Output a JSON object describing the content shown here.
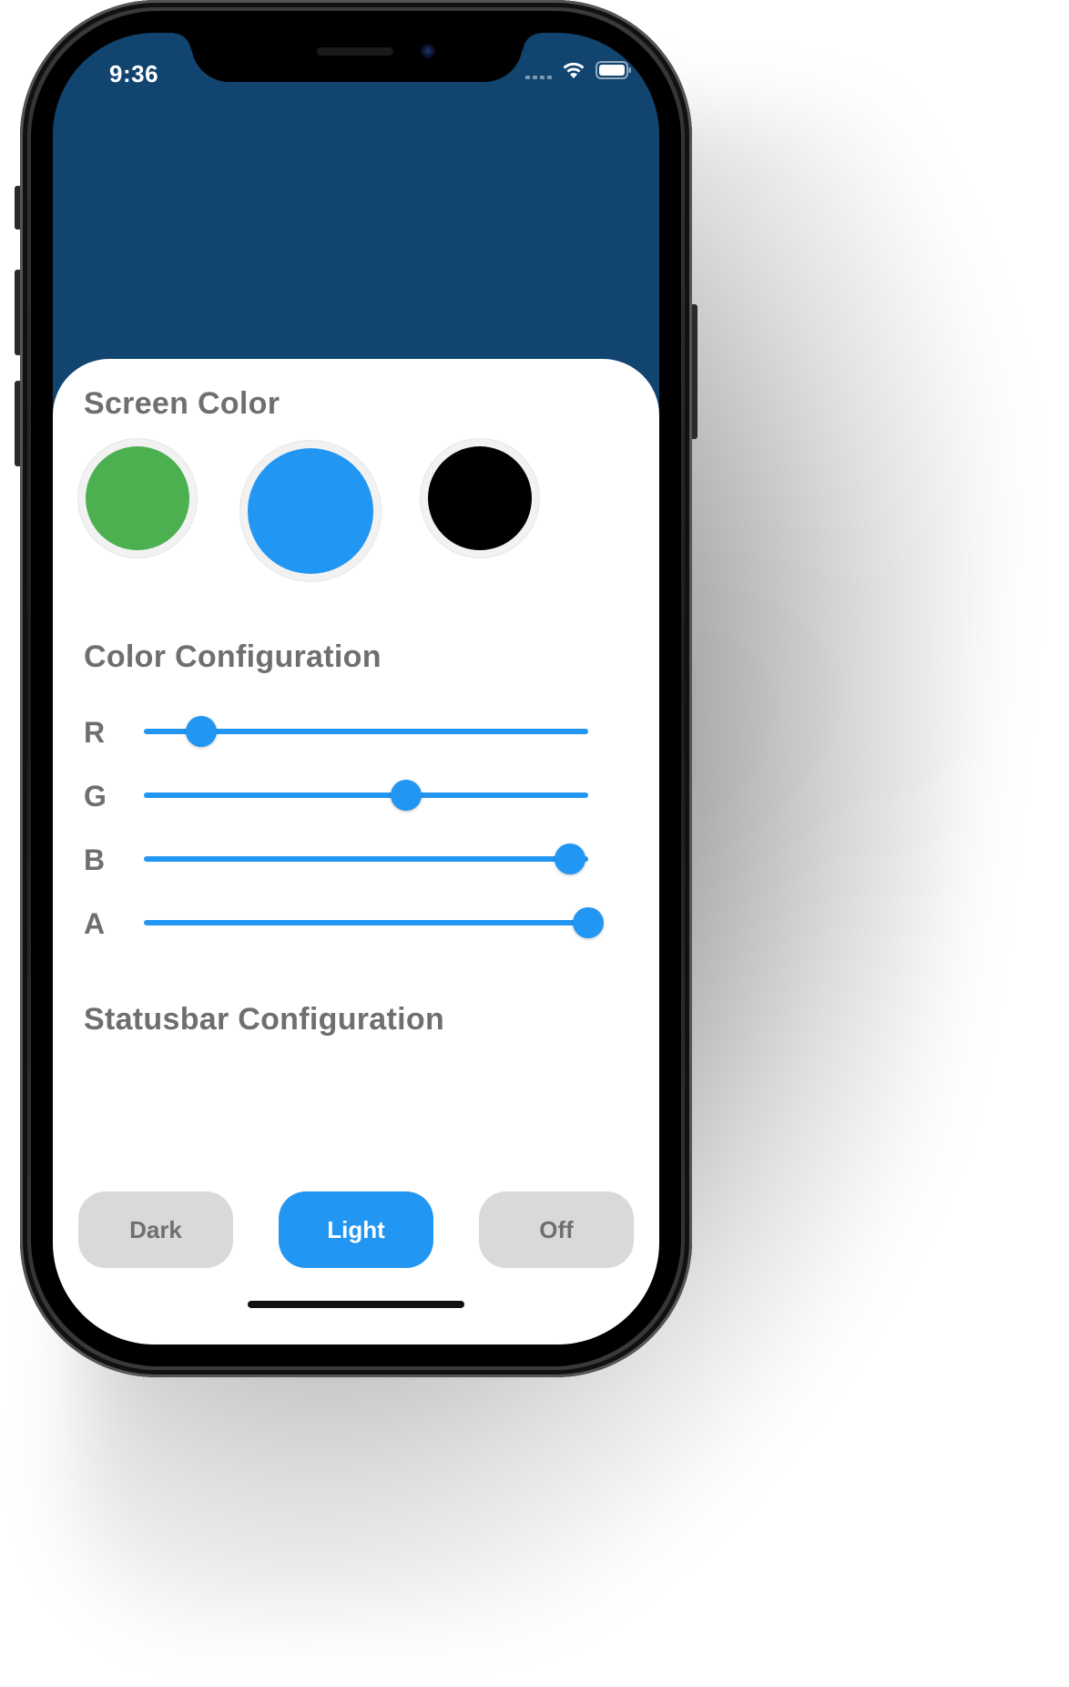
{
  "status_bar": {
    "time": "9:36",
    "wifi_icon": "wifi-icon",
    "battery_icon": "battery-icon"
  },
  "theme": {
    "background": "#124470",
    "accent": "#2196f3",
    "sheet": "#ffffff",
    "label_color": "#6f6f6f",
    "button_inactive": "#d9d9d9"
  },
  "screen_color": {
    "title": "Screen Color",
    "swatches": [
      {
        "name": "green",
        "color": "#4caf50",
        "selected": false
      },
      {
        "name": "blue",
        "color": "#2196f3",
        "selected": true
      },
      {
        "name": "black",
        "color": "#000000",
        "selected": false
      }
    ]
  },
  "color_configuration": {
    "title": "Color Configuration",
    "sliders": [
      {
        "label": "R",
        "value": 0.13
      },
      {
        "label": "G",
        "value": 0.59
      },
      {
        "label": "B",
        "value": 0.96
      },
      {
        "label": "A",
        "value": 1.0
      }
    ]
  },
  "statusbar_configuration": {
    "title": "Statusbar Configuration",
    "options": [
      {
        "label": "Dark",
        "active": false
      },
      {
        "label": "Light",
        "active": true
      },
      {
        "label": "Off",
        "active": false
      }
    ]
  }
}
